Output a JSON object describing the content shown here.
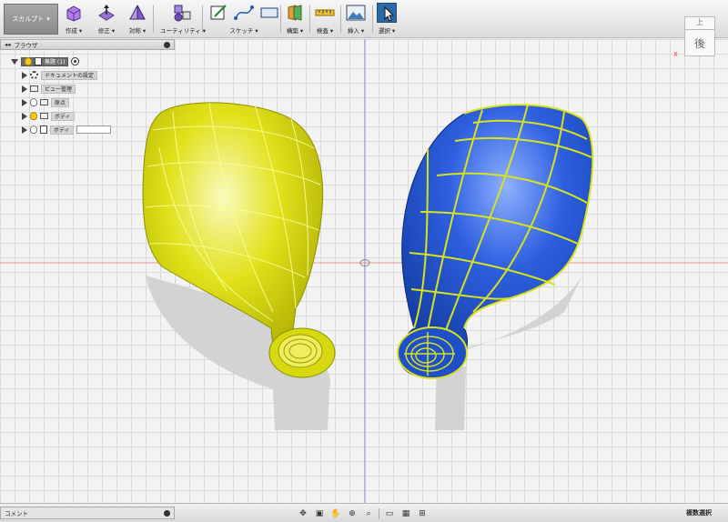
{
  "toolbar": {
    "workspace": "スカルプト",
    "tools": [
      {
        "label": "作成"
      },
      {
        "label": "修正"
      },
      {
        "label": "対称"
      },
      {
        "label": "ユーティリティ"
      },
      {
        "label": "スケッチ"
      },
      {
        "label": "構築"
      },
      {
        "label": "検査"
      },
      {
        "label": "挿入"
      },
      {
        "label": "選択"
      }
    ]
  },
  "browser": {
    "title": "ブラウザ",
    "root": "無題 (1)",
    "items": [
      "ドキュメントの設定",
      "ビュー管理",
      "原点",
      "ボディ",
      "ボディ"
    ]
  },
  "viewcube": {
    "top": "上",
    "front": "後",
    "axis": "X"
  },
  "comment": {
    "label": "コメント"
  },
  "status": {
    "multi_select": "複数選択"
  },
  "colors": {
    "yellow_body": "#e6e600",
    "blue_body": "#1f4fc9",
    "wire": "#e0e81a"
  }
}
